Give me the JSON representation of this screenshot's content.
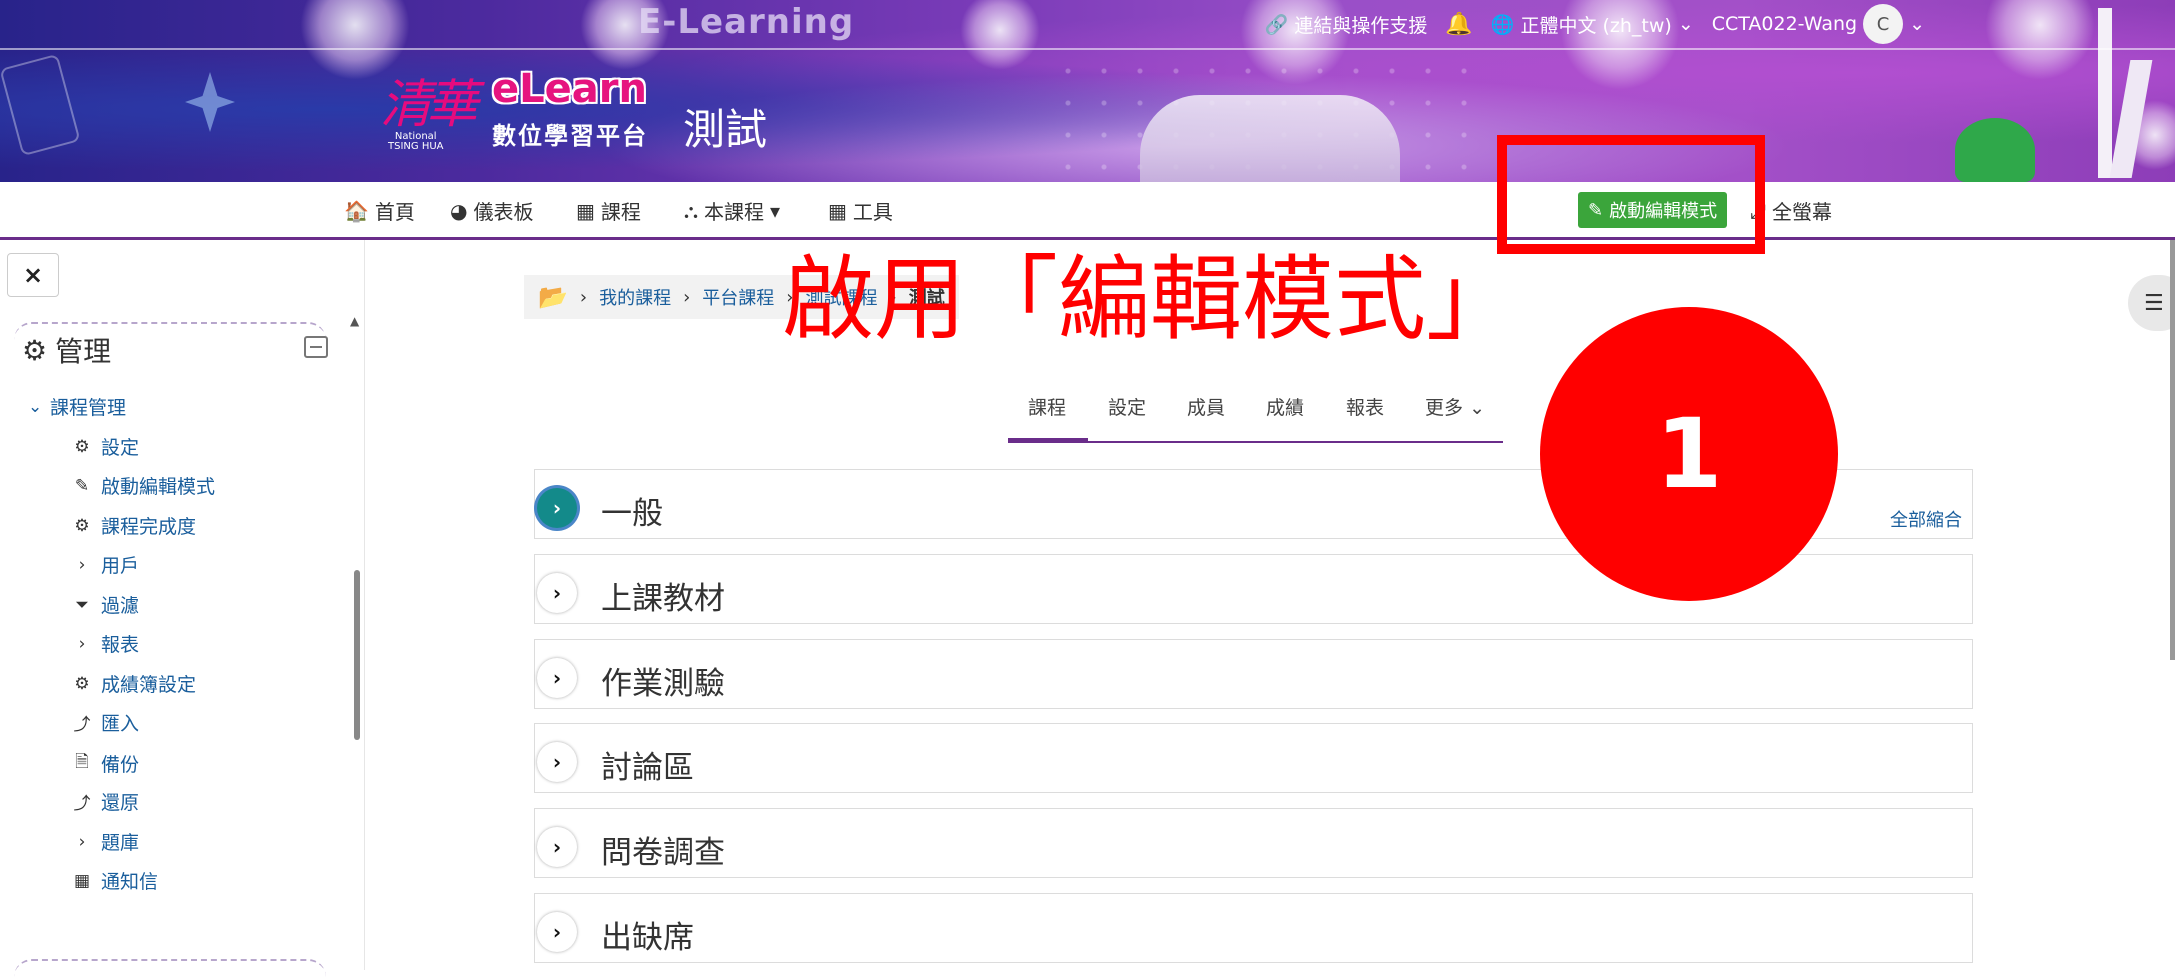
{
  "banner": {
    "site_title": "E-Learning",
    "logo_kanji": "清華",
    "logo_national": "National",
    "logo_tsinghua": "TSING HUA",
    "logo_elearn": "eLearn",
    "logo_subtitle": "數位學習平台",
    "course_title": "測試"
  },
  "topbar": {
    "support_link": "連結與操作支援",
    "language": "正體中文 (zh_tw)",
    "username": "CCTA022-Wang",
    "avatar_initial": "C"
  },
  "navbar": {
    "home": "首頁",
    "dashboard": "儀表板",
    "courses": "課程",
    "this_course": "本課程",
    "tools": "工具",
    "edit_mode_button": "啟動編輯模式",
    "fullscreen": "全螢幕"
  },
  "sidebar": {
    "close_label": "×",
    "heading": "管理",
    "course_admin": "課程管理",
    "items": [
      {
        "label": "設定",
        "icon": "gear-icon"
      },
      {
        "label": "啟動編輯模式",
        "icon": "pencil-icon"
      },
      {
        "label": "課程完成度",
        "icon": "gear-icon"
      },
      {
        "label": "用戶",
        "icon": "chevron-right-icon"
      },
      {
        "label": "過濾",
        "icon": "filter-icon"
      },
      {
        "label": "報表",
        "icon": "chevron-right-icon"
      },
      {
        "label": "成績簿設定",
        "icon": "gear-icon"
      },
      {
        "label": "匯入",
        "icon": "upload-icon"
      },
      {
        "label": "備份",
        "icon": "file-icon"
      },
      {
        "label": "還原",
        "icon": "upload-icon"
      },
      {
        "label": "題庫",
        "icon": "chevron-right-icon"
      },
      {
        "label": "通知信",
        "icon": "calendar-icon"
      }
    ]
  },
  "breadcrumb": {
    "my_courses": "我的課程",
    "platform_courses": "平台課程",
    "test_courses": "測試課程",
    "current": "測試"
  },
  "tabs": [
    "課程",
    "設定",
    "成員",
    "成績",
    "報表",
    "更多"
  ],
  "sections": [
    "一般",
    "上課教材",
    "作業測驗",
    "討論區",
    "問卷調查",
    "出缺席"
  ],
  "collapse_all": "全部縮合",
  "annotation": {
    "instruction": "啟用「編輯模式」",
    "step_number": "1",
    "color": "#ff0000"
  },
  "colors": {
    "accent": "#6a2d8a",
    "edit_button": "#3ba53b",
    "link": "#1a5e9c",
    "active_section": "#138a8a"
  }
}
